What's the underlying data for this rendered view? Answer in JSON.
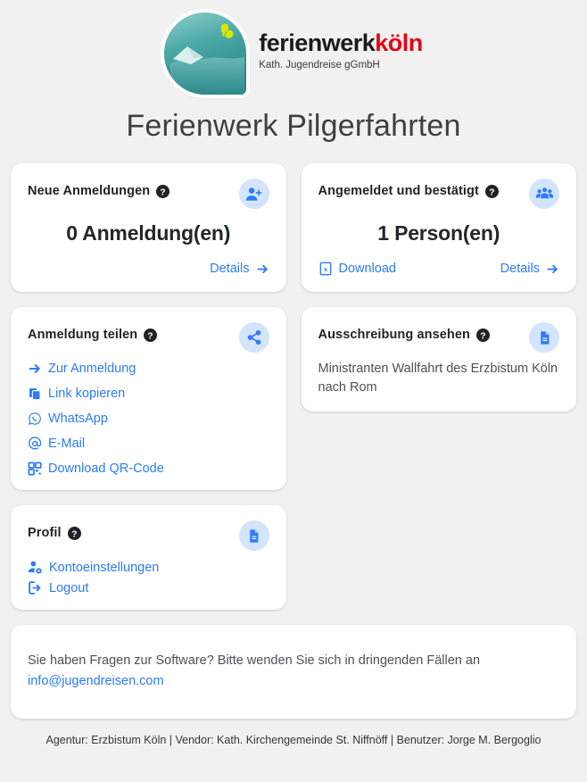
{
  "brand": {
    "name_part1": "ferienwerk",
    "name_part2": "köln",
    "subtitle": "Kath. Jugendreise gGmbH",
    "accent_color": "#e30613"
  },
  "page_title": "Ferienwerk Pilgerfahrten",
  "theme": {
    "link_color": "#2b7cf6",
    "badge_bg": "#d3e4fd",
    "page_bg": "#f1f1f1",
    "card_bg": "#ffffff"
  },
  "cards": {
    "new_registrations": {
      "title": "Neue Anmeldungen",
      "help": "?",
      "icon": "person-add-icon",
      "metric": "0 Anmeldung(en)",
      "details_label": "Details"
    },
    "confirmed": {
      "title": "Angemeldet und bestätigt",
      "help": "?",
      "icon": "people-group-icon",
      "metric": "1 Person(en)",
      "download_label": "Download",
      "details_label": "Details"
    },
    "share": {
      "title": "Anmeldung teilen",
      "help": "?",
      "icon": "share-icon",
      "links": [
        {
          "label": "Zur Anmeldung",
          "icon": "arrow-right-icon"
        },
        {
          "label": "Link kopieren",
          "icon": "copy-icon"
        },
        {
          "label": "WhatsApp",
          "icon": "whatsapp-icon"
        },
        {
          "label": "E-Mail",
          "icon": "at-sign-icon"
        },
        {
          "label": "Download QR-Code",
          "icon": "qr-code-icon"
        }
      ]
    },
    "announcement": {
      "title": "Ausschreibung ansehen",
      "help": "?",
      "icon": "document-icon",
      "text": "Ministranten Wallfahrt des Erzbistum Köln nach Rom"
    },
    "profile": {
      "title": "Profil",
      "help": "?",
      "icon": "document-icon",
      "links": [
        {
          "label": "Kontoeinstellungen",
          "icon": "person-gear-icon"
        },
        {
          "label": "Logout",
          "icon": "sign-out-icon"
        }
      ]
    }
  },
  "support": {
    "text": "Sie haben Fragen zur Software? Bitte wenden Sie sich in dringenden Fällen an",
    "email": "info@jugendreisen.com"
  },
  "footer": {
    "text": "Agentur: Erzbistum Köln | Vendor: Kath. Kirchengemeinde St. Niffnöff | Benutzer: Jorge M. Bergoglio"
  }
}
